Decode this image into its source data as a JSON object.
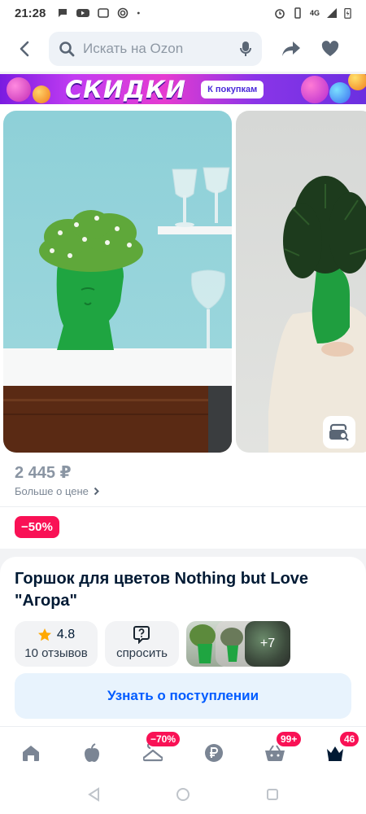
{
  "status_bar": {
    "time": "21:28",
    "network": "4G"
  },
  "app_bar": {
    "search_placeholder": "Искать на Ozon"
  },
  "banner": {
    "title": "СКИДКИ",
    "cta": "К покупкам"
  },
  "product": {
    "price": "2 445 ₽",
    "price_more": "Больше о цене",
    "discount": "−50%",
    "title": "Горшок для цветов Nothing but Love \"Агора\"",
    "rating": "4.8",
    "reviews": "10 отзывов",
    "ask_label": "спросить",
    "more_photos": "+7",
    "notify_button": "Узнать о поступлении"
  },
  "bottom_nav": {
    "items": [
      {
        "name": "home",
        "badge": ""
      },
      {
        "name": "fresh",
        "badge": ""
      },
      {
        "name": "sale",
        "badge": "−70%"
      },
      {
        "name": "finance",
        "badge": ""
      },
      {
        "name": "cart",
        "badge": "99+"
      },
      {
        "name": "profile",
        "badge": "46"
      }
    ]
  },
  "colors": {
    "accent": "#005bff",
    "discount": "#f91155",
    "notify_bg": "#e8f3fd",
    "plant_green": "#1fa541"
  }
}
